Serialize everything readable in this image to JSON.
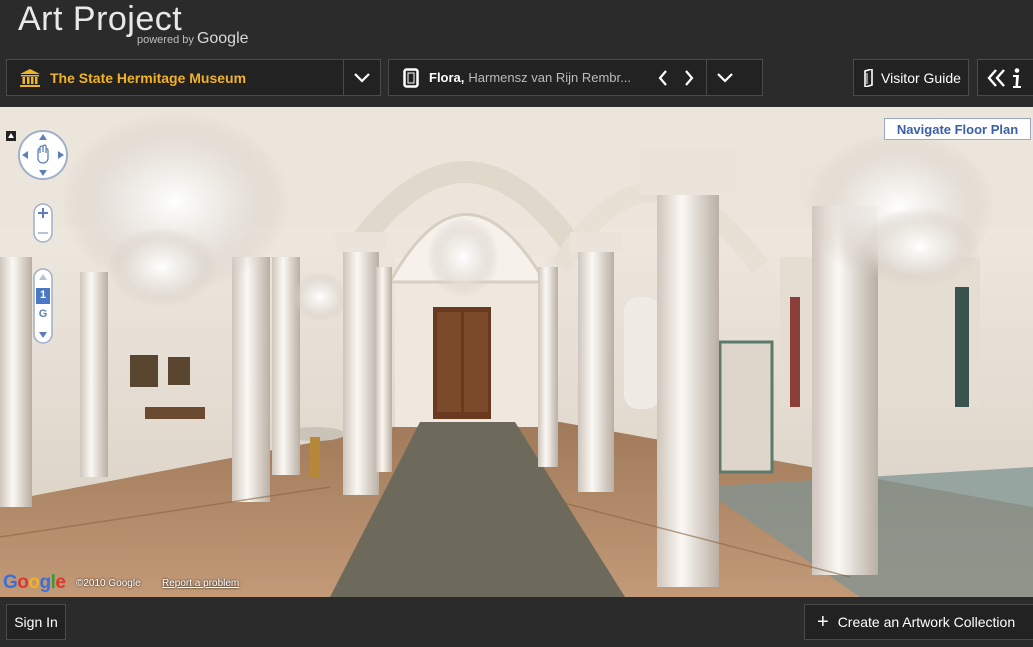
{
  "header": {
    "app_title": "Art Project",
    "powered_prefix": "powered by",
    "powered_brand": "Google"
  },
  "toolbar": {
    "museum_name": "The State Hermitage Museum",
    "artwork_title": "Flora,",
    "artwork_artist": "Harmensz van Rijn Rembr...",
    "visitor_guide_label": "Visitor Guide",
    "museum_icon": "museum-icon",
    "frame_icon": "frame-icon",
    "info_icon": "info-icon"
  },
  "viewer": {
    "floor_plan_label": "Navigate Floor Plan",
    "level_selected": "1",
    "level_ground": "G",
    "copyright": "©2010 Google",
    "report_label": "Report a problem",
    "google_mark": "Google"
  },
  "footer": {
    "sign_in_label": "Sign In",
    "create_collection_label": "Create an Artwork Collection"
  },
  "colors": {
    "accent": "#f2b225",
    "link_blue": "#3a5fa6",
    "chrome_bg": "#2b2b2b"
  }
}
